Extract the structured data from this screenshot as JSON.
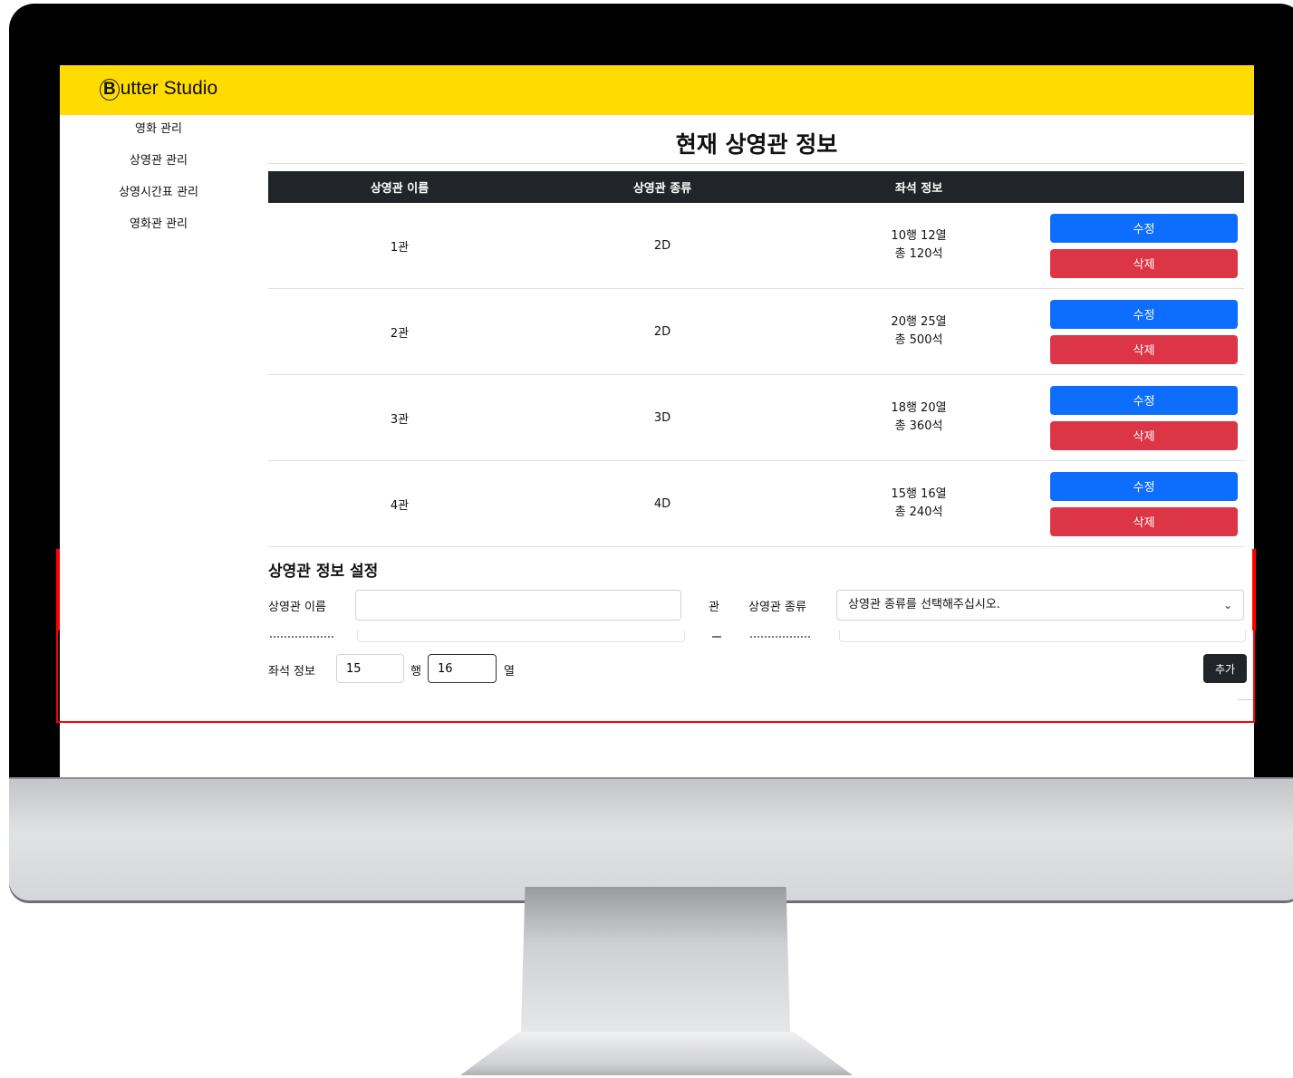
{
  "app": {
    "logo_initial": "B",
    "logo_text": "utter Studio"
  },
  "sidebar": {
    "items": [
      {
        "label": "영화 관리"
      },
      {
        "label": "상영관 관리"
      },
      {
        "label": "상영시간표 관리"
      },
      {
        "label": "영화관 관리"
      }
    ]
  },
  "main": {
    "title": "현재 상영관 정보",
    "table": {
      "headers": [
        "상영관 이름",
        "상영관 종류",
        "좌석 정보",
        ""
      ],
      "rows": [
        {
          "name": "1관",
          "type": "2D",
          "seats_rc": "10행 12열",
          "seats_total": "총 120석"
        },
        {
          "name": "2관",
          "type": "2D",
          "seats_rc": "20행 25열",
          "seats_total": "총 500석"
        },
        {
          "name": "3관",
          "type": "3D",
          "seats_rc": "18행 20열",
          "seats_total": "총 360석"
        },
        {
          "name": "4관",
          "type": "4D",
          "seats_rc": "15행 16열",
          "seats_total": "총 240석"
        }
      ],
      "edit_label": "수정",
      "delete_label": "삭제"
    }
  },
  "form": {
    "title": "상영관 정보 설정",
    "name_label": "상영관 이름",
    "name_value": "",
    "name_suffix": "관",
    "type_label": "상영관 종류",
    "type_placeholder": "상영관 종류를 선택해주십시오.",
    "seat_label": "좌석 정보",
    "rows_value": "15",
    "rows_suffix": "행",
    "cols_value": "16",
    "cols_suffix": "열",
    "add_label": "추가"
  },
  "colors": {
    "header_bg": "#ffdc00",
    "edit": "#0d6efd",
    "delete": "#dc3545",
    "dark": "#212529",
    "highlight": "#ff0000"
  }
}
